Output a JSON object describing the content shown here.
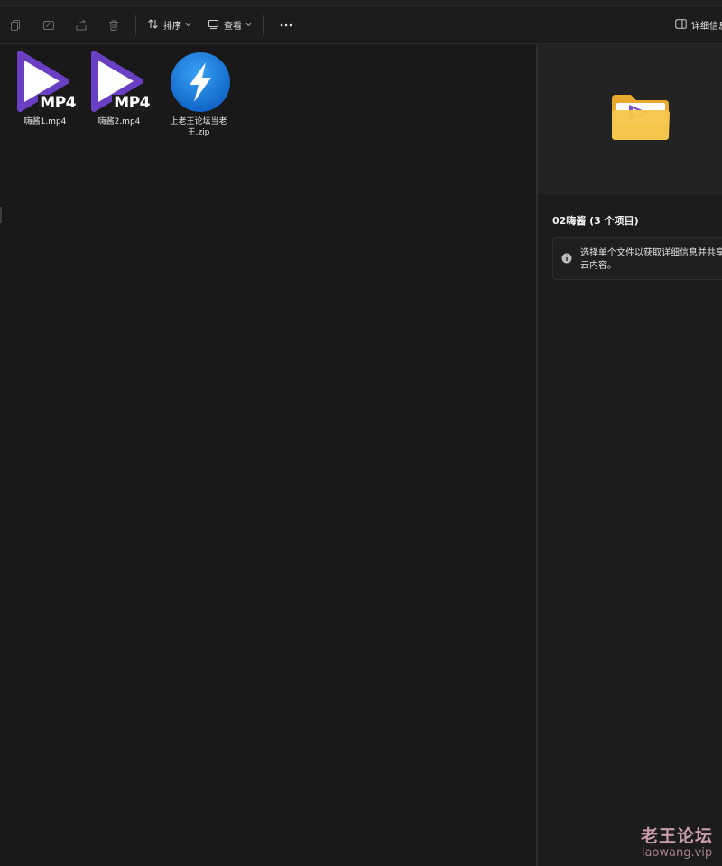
{
  "toolbar": {
    "icons": [
      "copy-icon",
      "rename-icon",
      "share-icon",
      "delete-icon"
    ],
    "sort_label": "排序",
    "view_label": "查看",
    "more_icon": "more-icon",
    "details_label": "详细信息"
  },
  "files": [
    {
      "name": "嗨酱1.mp4",
      "type": "video",
      "badge": "MP4"
    },
    {
      "name": "嗨酱2.mp4",
      "type": "video",
      "badge": "MP4"
    },
    {
      "name": "上老王论坛当老王.zip",
      "type": "archive"
    }
  ],
  "details_pane": {
    "folder_title": "02嗨酱 (3 个项目)",
    "info_message": "选择单个文件以获取详细信息并共享云内容。"
  },
  "watermark": {
    "title": "老王论坛",
    "url": "laowang.vip"
  },
  "colors": {
    "background": "#191919",
    "accent_purple": "#6a3fc4",
    "archive_blue": "#1a73d9",
    "folder_yellow": "#f6c64d"
  }
}
